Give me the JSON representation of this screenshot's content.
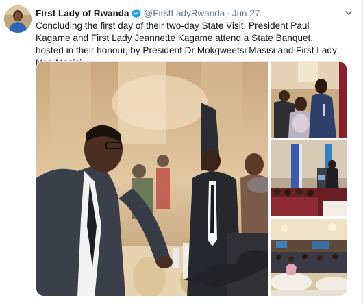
{
  "tweet": {
    "author_name": "First Lady of Rwanda",
    "handle": "@FirstLadyRwanda",
    "separator": "·",
    "date": "Jun 27",
    "text": "Concluding the first day of their two-day State Visit, President Paul Kagame and First Lady Jeannette Kagame attend a State Banquet, hosted in their honour, by President Dr Mokgweetsi Masisi and First Lady Neo Masisi."
  },
  "icons": {
    "verified": "verified-badge-icon",
    "more": "chevron-down-icon"
  },
  "colors": {
    "accent": "#1da1f2",
    "text": "#14171a",
    "muted": "#657786"
  }
}
